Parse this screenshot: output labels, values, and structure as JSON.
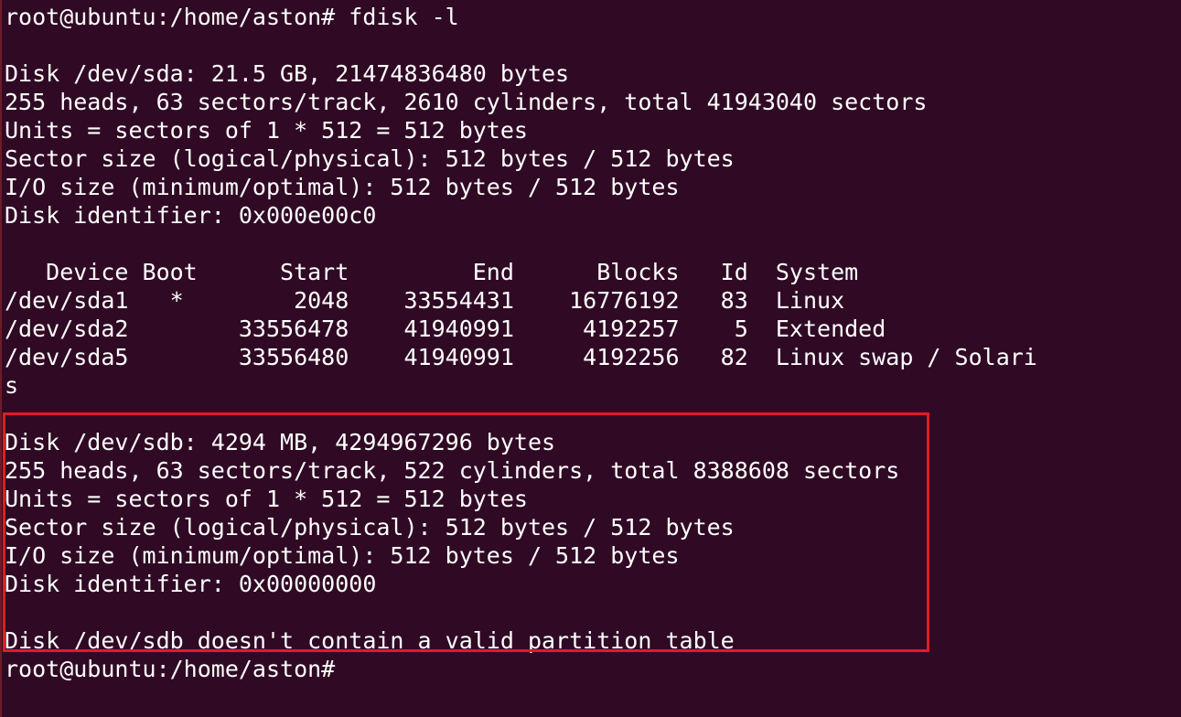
{
  "terminal": {
    "background": "#300a24",
    "foreground": "#ffffff",
    "highlight_color": "#e01b24",
    "lines": [
      "root@ubuntu:/home/aston# fdisk -l",
      "",
      "Disk /dev/sda: 21.5 GB, 21474836480 bytes",
      "255 heads, 63 sectors/track, 2610 cylinders, total 41943040 sectors",
      "Units = sectors of 1 * 512 = 512 bytes",
      "Sector size (logical/physical): 512 bytes / 512 bytes",
      "I/O size (minimum/optimal): 512 bytes / 512 bytes",
      "Disk identifier: 0x000e00c0",
      "",
      "   Device Boot      Start         End      Blocks   Id  System",
      "/dev/sda1   *        2048    33554431    16776192   83  Linux",
      "/dev/sda2        33556478    41940991     4192257    5  Extended",
      "/dev/sda5        33556480    41940991     4192256   82  Linux swap / Solari",
      "s",
      "",
      "Disk /dev/sdb: 4294 MB, 4294967296 bytes",
      "255 heads, 63 sectors/track, 522 cylinders, total 8388608 sectors",
      "Units = sectors of 1 * 512 = 512 bytes",
      "Sector size (logical/physical): 512 bytes / 512 bytes",
      "I/O size (minimum/optimal): 512 bytes / 512 bytes",
      "Disk identifier: 0x00000000",
      "",
      "Disk /dev/sdb doesn't contain a valid partition table",
      "root@ubuntu:/home/aston#"
    ]
  }
}
